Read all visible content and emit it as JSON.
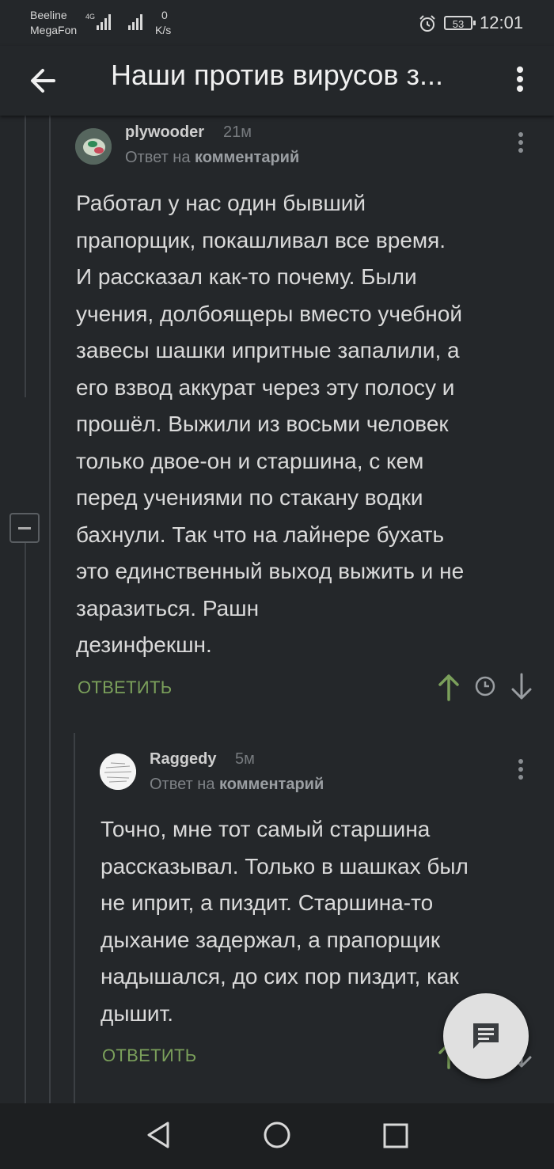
{
  "status_bar": {
    "carrier_1": "Beeline",
    "carrier_2": "MegaFon",
    "network_type": "4G",
    "net_speed_value": "0",
    "net_speed_unit": "K/s",
    "battery": "53",
    "time": "12:01"
  },
  "app_bar": {
    "title": "Наши против вирусов з...",
    "back_icon": "arrow-left-icon",
    "menu_icon": "more-vertical-icon"
  },
  "comments": [
    {
      "username": "plywooder",
      "time": "21м",
      "reply_prefix": "Ответ на",
      "reply_target": "комментарий",
      "lines": [
        "Работал у нас один бывший",
        "прапорщик, покашливал все время.",
        "И рассказал как-то почему. Были",
        "учения, долбоящеры вместо учебной",
        "завесы шашки ипритные запалили, а",
        "его взвод аккурат через эту полосу и",
        "прошёл. Выжили из восьми человек",
        "только двое-он и старшина, с кем",
        "перед учениями по стакану водки",
        "бахнули. Так что на лайнере бухать",
        "это единственный выход выжить и не",
        "заразиться. Рашн",
        "дезинфекшн."
      ],
      "reply_label": "ОТВЕТИТЬ"
    },
    {
      "username": "Raggedy",
      "time": "5м",
      "reply_prefix": "Ответ на",
      "reply_target": "комментарий",
      "lines": [
        "Точно, мне тот самый старшина",
        "рассказывал. Только в шашках был",
        "не иприт, а пиздит. Старшина-то",
        "дыхание задержал, а прапорщик",
        "надышался, до сих пор пиздит, как",
        "дышит."
      ],
      "reply_label": "ОТВЕТИТЬ"
    }
  ],
  "colors": {
    "background": "#24272a",
    "accent_green": "#7ba05b",
    "text": "#dadada"
  },
  "fab_icon": "comment-icon",
  "nav_icons": [
    "nav-back-icon",
    "nav-home-icon",
    "nav-recent-icon"
  ]
}
